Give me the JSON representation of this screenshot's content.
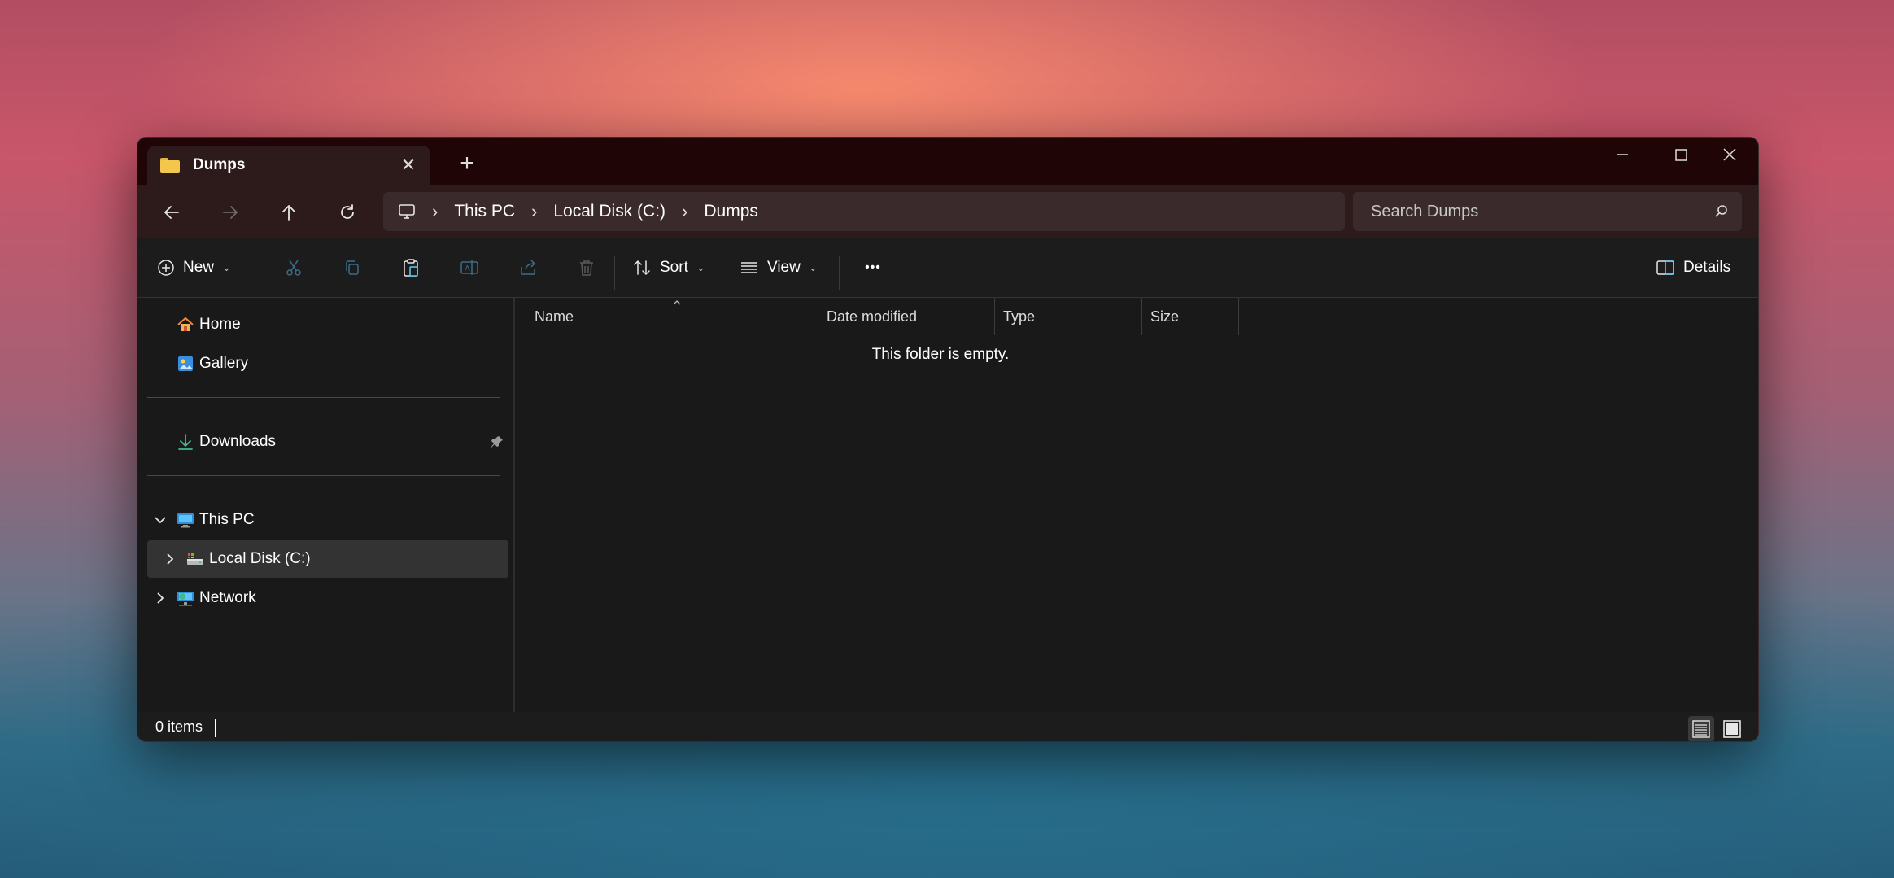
{
  "window": {
    "tab_title": "Dumps",
    "new_tab_symbol": "+",
    "close_symbol": "✕"
  },
  "address_bar": {
    "crumbs": [
      "This PC",
      "Local Disk (C:)",
      "Dumps"
    ]
  },
  "search": {
    "placeholder": "Search Dumps"
  },
  "commands": {
    "new_label": "New",
    "sort_label": "Sort",
    "view_label": "View",
    "more_label": "•••",
    "details_label": "Details"
  },
  "sidebar": {
    "quick": [
      {
        "label": "Home",
        "icon": "home-icon"
      },
      {
        "label": "Gallery",
        "icon": "gallery-icon"
      }
    ],
    "pinned": [
      {
        "label": "Downloads",
        "icon": "download-icon"
      }
    ],
    "tree": [
      {
        "label": "This PC",
        "icon": "computer-icon",
        "expanded": true
      },
      {
        "label": "Local Disk (C:)",
        "icon": "drive-icon",
        "selected": true
      },
      {
        "label": "Network",
        "icon": "network-icon"
      }
    ]
  },
  "columns": [
    "Name",
    "Date modified",
    "Type",
    "Size"
  ],
  "empty_message": "This folder is empty.",
  "status": {
    "item_count": "0 items"
  },
  "colors": {
    "titlebar": "#1f0506",
    "navbar": "#2d1a1b",
    "window_bg": "#191919",
    "accent": "#60cdff"
  }
}
